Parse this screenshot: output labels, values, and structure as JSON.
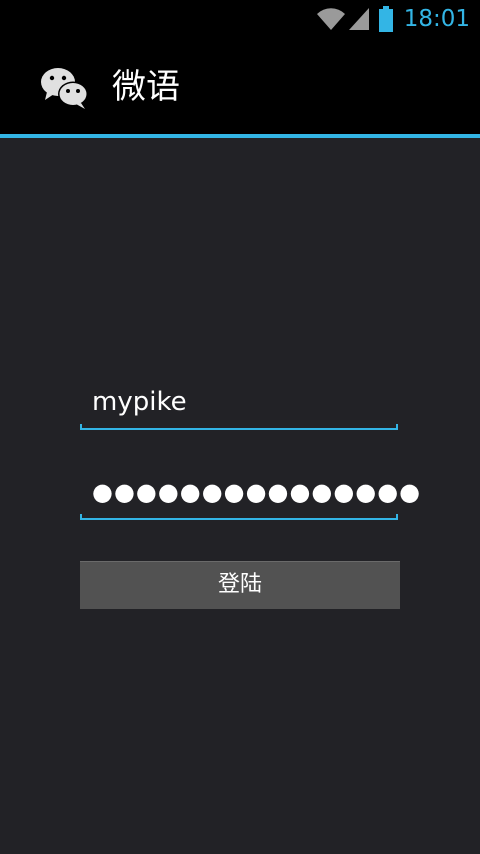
{
  "status_bar": {
    "time": "18:01",
    "icons": [
      "wifi-icon",
      "signal-icon",
      "battery-icon"
    ],
    "accent_color": "#33b5e5"
  },
  "action_bar": {
    "app_icon": "wechat-icon",
    "title": "微语"
  },
  "login_form": {
    "username_value": "mypike",
    "password_value": "●●●●●●●●●●●●●●●",
    "login_button_label": "登陆"
  },
  "colors": {
    "background": "#222226",
    "bar_background": "#000000",
    "accent": "#33b5e5",
    "button_background": "#525252"
  }
}
